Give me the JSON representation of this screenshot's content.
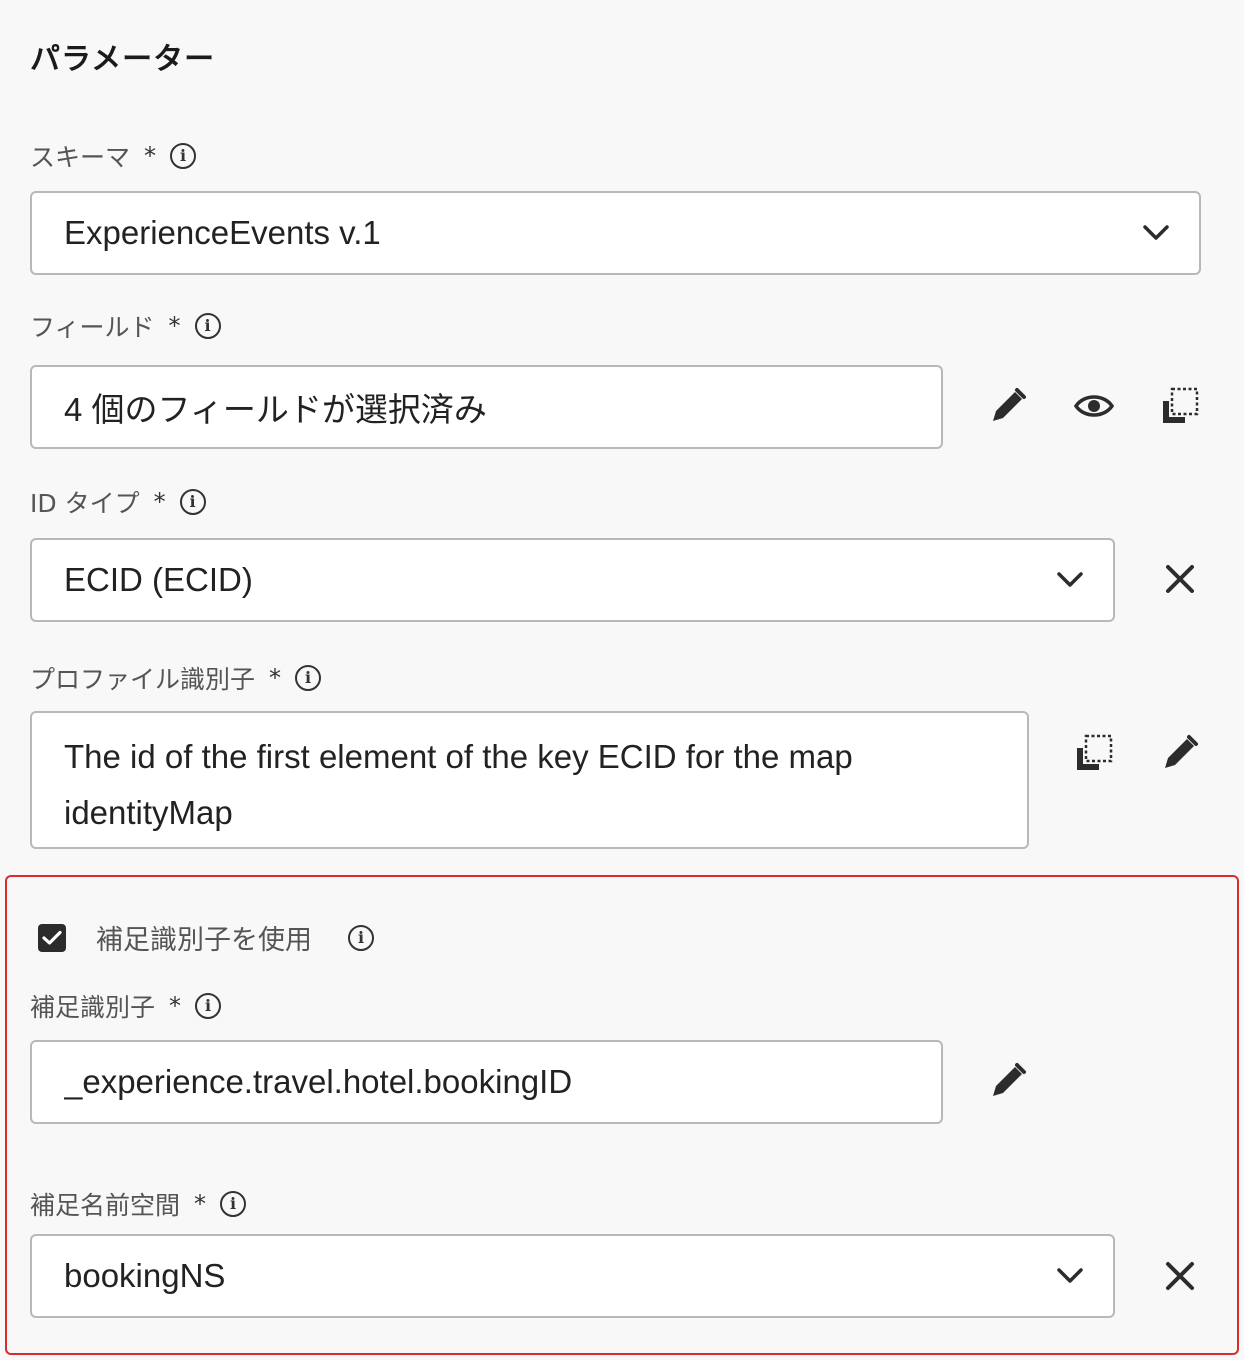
{
  "panel": {
    "title": "パラメーター"
  },
  "schema": {
    "label": "スキーマ",
    "required_mark": "*",
    "value": "ExperienceEvents v.1"
  },
  "fields": {
    "label": "フィールド",
    "required_mark": "*",
    "value": "4 個のフィールドが選択済み"
  },
  "id_type": {
    "label": "ID タイプ",
    "required_mark": "*",
    "value": "ECID (ECID)"
  },
  "profile_identifier": {
    "label": "プロファイル識別子",
    "required_mark": "*",
    "value": "The id of the first element of the key ECID for the map identityMap"
  },
  "supplemental": {
    "checkbox_label": "補足識別子を使用",
    "checked": true,
    "identifier": {
      "label": "補足識別子",
      "required_mark": "*",
      "value": "_experience.travel.hotel.bookingID"
    },
    "namespace": {
      "label": "補足名前空間",
      "required_mark": "*",
      "value": "bookingNS"
    }
  },
  "colors": {
    "highlight_border": "#d92d2d",
    "icon": "#2c2c2c",
    "field_border": "#b8b8b8"
  },
  "icons": [
    "info-icon",
    "chevron-down-icon",
    "pencil-icon",
    "eye-icon",
    "copy-icon",
    "close-icon",
    "checkmark-icon"
  ]
}
